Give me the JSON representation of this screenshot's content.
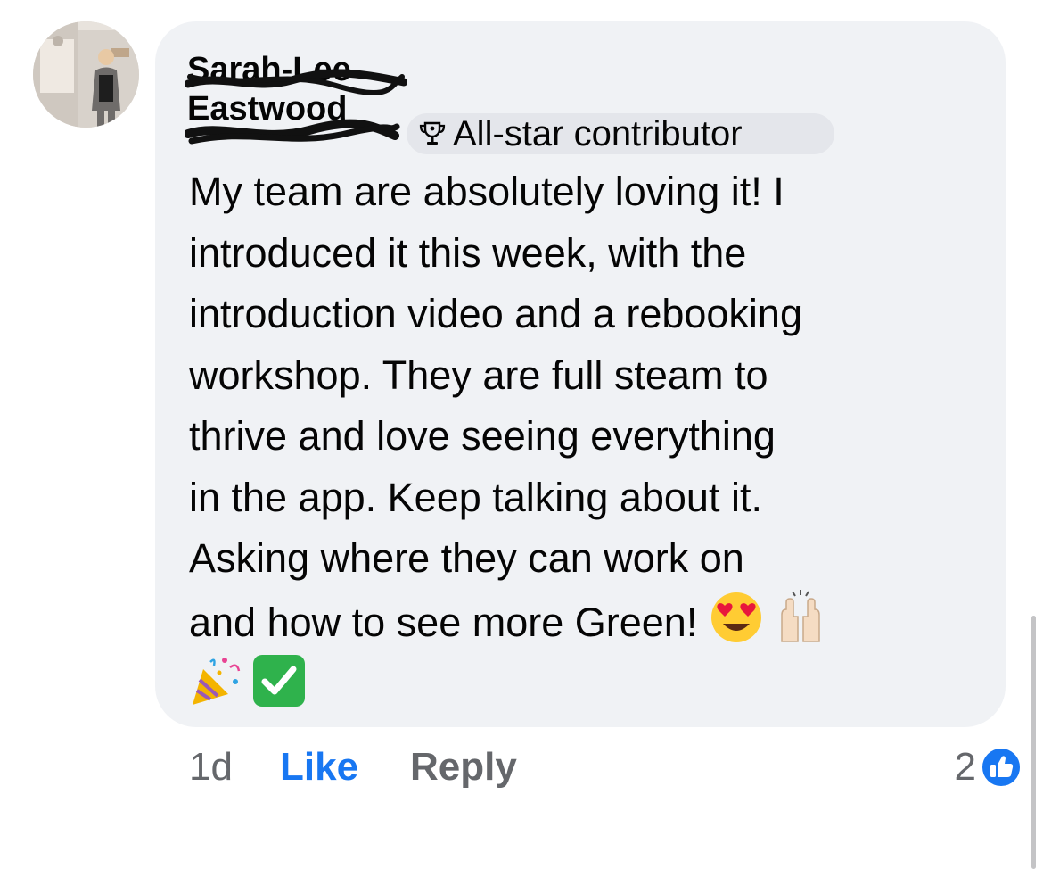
{
  "comment": {
    "author_line1": "Sarah-Lee",
    "author_line2": "Eastwood",
    "badge_label": "All-star contributor",
    "text": "My team are absolutely loving it! I\nintroduced it this week, with the\nintroduction video and a rebooking\nworkshop. They are full steam to\nthrive and love seeing everything\nin the app. Keep talking about it.\nAsking where they can work on\nand how to see more Green! ",
    "emojis": [
      "heart-eyes-emoji",
      "raising-hands-emoji",
      "party-popper-emoji",
      "check-mark-button-emoji"
    ]
  },
  "footer": {
    "time": "1d",
    "like_label": "Like",
    "reply_label": "Reply",
    "reaction_count": "2"
  },
  "colors": {
    "bubble": "#f0f2f5",
    "badge": "#e4e6eb",
    "like_blue": "#1877f2",
    "muted": "#65676b",
    "check_green": "#2fb24c"
  },
  "icons": {
    "badge": "trophy-icon",
    "reaction": "like-thumb-icon"
  }
}
